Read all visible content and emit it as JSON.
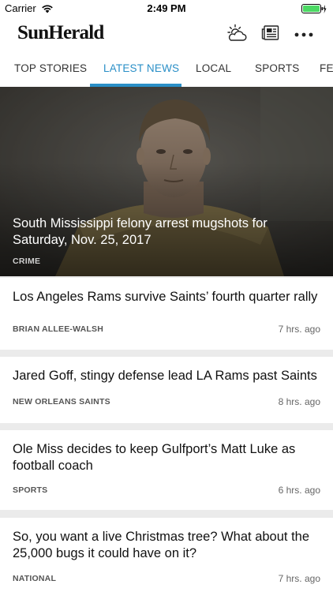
{
  "status_bar": {
    "carrier": "Carrier",
    "time": "2:49 PM"
  },
  "header": {
    "logo": "SunHerald",
    "icons": [
      "weather-icon",
      "eedition-icon",
      "more-icon"
    ]
  },
  "tabs": [
    {
      "label": "TOP STORIES",
      "active": false
    },
    {
      "label": "LATEST NEWS",
      "active": true
    },
    {
      "label": "LOCAL",
      "active": false
    },
    {
      "label": "SPORTS",
      "active": false
    },
    {
      "label": "FEATURES",
      "active": false
    }
  ],
  "hero": {
    "title": "South Mississippi felony arrest mugshots for Saturday, Nov. 25, 2017",
    "category": "CRIME"
  },
  "articles": [
    {
      "title": "Los Angeles Rams survive Saints’ fourth quarter rally",
      "category": "BRIAN ALLEE-WALSH",
      "time": "7 hrs. ago"
    },
    {
      "title": "Jared Goff, stingy defense lead LA Rams past Saints",
      "category": "NEW ORLEANS SAINTS",
      "time": "8 hrs. ago"
    },
    {
      "title": "Ole Miss decides to keep Gulfport’s Matt Luke as football coach",
      "category": "SPORTS",
      "time": "6 hrs. ago"
    },
    {
      "title": "So, you want a live Christmas tree? What about the 25,000 bugs it could have on it?",
      "category": "NATIONAL",
      "time": "7 hrs. ago"
    }
  ],
  "colors": {
    "accent": "#2a8fc7",
    "battery": "#4cd964"
  }
}
